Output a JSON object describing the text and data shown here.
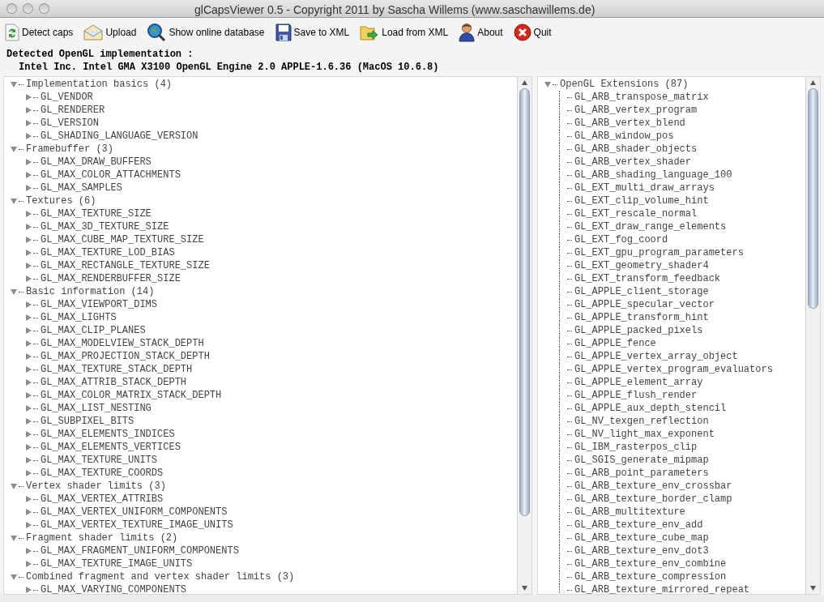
{
  "window": {
    "title": "glCapsViewer 0.5 - Copyright 2011 by Sascha Willems (www.saschawillems.de)"
  },
  "toolbar": [
    {
      "kind": "detect",
      "label": "Detect caps"
    },
    {
      "kind": "upload",
      "label": "Upload"
    },
    {
      "kind": "database",
      "label": "Show online database"
    },
    {
      "kind": "save",
      "label": "Save to XML"
    },
    {
      "kind": "load",
      "label": "Load from XML"
    },
    {
      "kind": "about",
      "label": "About"
    },
    {
      "kind": "quit",
      "label": "Quit"
    }
  ],
  "implementation": {
    "heading": "Detected OpenGL implementation :",
    "renderer": "Intel Inc. Intel GMA X3100 OpenGL Engine 2.0 APPLE-1.6.36 (MacOS 10.6.8)"
  },
  "caps_tree": [
    {
      "label": "Implementation basics (4)",
      "expanded": true,
      "children": [
        {
          "label": "GL_VENDOR",
          "expanded": false
        },
        {
          "label": "GL_RENDERER",
          "expanded": false
        },
        {
          "label": "GL_VERSION",
          "expanded": false
        },
        {
          "label": "GL_SHADING_LANGUAGE_VERSION",
          "expanded": false
        }
      ]
    },
    {
      "label": "Framebuffer (3)",
      "expanded": true,
      "children": [
        {
          "label": "GL_MAX_DRAW_BUFFERS",
          "expanded": false
        },
        {
          "label": "GL_MAX_COLOR_ATTACHMENTS",
          "expanded": false
        },
        {
          "label": "GL_MAX_SAMPLES",
          "expanded": false
        }
      ]
    },
    {
      "label": "Textures (6)",
      "expanded": true,
      "children": [
        {
          "label": "GL_MAX_TEXTURE_SIZE",
          "expanded": false
        },
        {
          "label": "GL_MAX_3D_TEXTURE_SIZE",
          "expanded": false
        },
        {
          "label": "GL_MAX_CUBE_MAP_TEXTURE_SIZE",
          "expanded": false
        },
        {
          "label": "GL_MAX_TEXTURE_LOD_BIAS",
          "expanded": false
        },
        {
          "label": "GL_MAX_RECTANGLE_TEXTURE_SIZE",
          "expanded": false
        },
        {
          "label": "GL_MAX_RENDERBUFFER_SIZE",
          "expanded": false
        }
      ]
    },
    {
      "label": "Basic information (14)",
      "expanded": true,
      "children": [
        {
          "label": "GL_MAX_VIEWPORT_DIMS",
          "expanded": false
        },
        {
          "label": "GL_MAX_LIGHTS",
          "expanded": false
        },
        {
          "label": "GL_MAX_CLIP_PLANES",
          "expanded": false
        },
        {
          "label": "GL_MAX_MODELVIEW_STACK_DEPTH",
          "expanded": false
        },
        {
          "label": "GL_MAX_PROJECTION_STACK_DEPTH",
          "expanded": false
        },
        {
          "label": "GL_MAX_TEXTURE_STACK_DEPTH",
          "expanded": false
        },
        {
          "label": "GL_MAX_ATTRIB_STACK_DEPTH",
          "expanded": false
        },
        {
          "label": "GL_MAX_COLOR_MATRIX_STACK_DEPTH",
          "expanded": false
        },
        {
          "label": "GL_MAX_LIST_NESTING",
          "expanded": false
        },
        {
          "label": "GL_SUBPIXEL_BITS",
          "expanded": false
        },
        {
          "label": "GL_MAX_ELEMENTS_INDICES",
          "expanded": false
        },
        {
          "label": "GL_MAX_ELEMENTS_VERTICES",
          "expanded": false
        },
        {
          "label": "GL_MAX_TEXTURE_UNITS",
          "expanded": false
        },
        {
          "label": "GL_MAX_TEXTURE_COORDS",
          "expanded": false
        }
      ]
    },
    {
      "label": "Vertex shader limits (3)",
      "expanded": true,
      "children": [
        {
          "label": "GL_MAX_VERTEX_ATTRIBS",
          "expanded": false
        },
        {
          "label": "GL_MAX_VERTEX_UNIFORM_COMPONENTS",
          "expanded": false
        },
        {
          "label": "GL_MAX_VERTEX_TEXTURE_IMAGE_UNITS",
          "expanded": false
        }
      ]
    },
    {
      "label": "Fragment shader limits (2)",
      "expanded": true,
      "children": [
        {
          "label": "GL_MAX_FRAGMENT_UNIFORM_COMPONENTS",
          "expanded": false
        },
        {
          "label": "GL_MAX_TEXTURE_IMAGE_UNITS",
          "expanded": false
        }
      ]
    },
    {
      "label": "Combined fragment and vertex shader limits (3)",
      "expanded": true,
      "children": [
        {
          "label": "GL_MAX_VARYING_COMPONENTS",
          "expanded": false
        }
      ]
    }
  ],
  "extensions_tree": [
    {
      "label": "OpenGL Extensions (87)",
      "expanded": true,
      "children": [
        {
          "label": "GL_ARB_transpose_matrix"
        },
        {
          "label": "GL_ARB_vertex_program"
        },
        {
          "label": "GL_ARB_vertex_blend"
        },
        {
          "label": "GL_ARB_window_pos"
        },
        {
          "label": "GL_ARB_shader_objects"
        },
        {
          "label": "GL_ARB_vertex_shader"
        },
        {
          "label": "GL_ARB_shading_language_100"
        },
        {
          "label": "GL_EXT_multi_draw_arrays"
        },
        {
          "label": "GL_EXT_clip_volume_hint"
        },
        {
          "label": "GL_EXT_rescale_normal"
        },
        {
          "label": "GL_EXT_draw_range_elements"
        },
        {
          "label": "GL_EXT_fog_coord"
        },
        {
          "label": "GL_EXT_gpu_program_parameters"
        },
        {
          "label": "GL_EXT_geometry_shader4"
        },
        {
          "label": "GL_EXT_transform_feedback"
        },
        {
          "label": "GL_APPLE_client_storage"
        },
        {
          "label": "GL_APPLE_specular_vector"
        },
        {
          "label": "GL_APPLE_transform_hint"
        },
        {
          "label": "GL_APPLE_packed_pixels"
        },
        {
          "label": "GL_APPLE_fence"
        },
        {
          "label": "GL_APPLE_vertex_array_object"
        },
        {
          "label": "GL_APPLE_vertex_program_evaluators"
        },
        {
          "label": "GL_APPLE_element_array"
        },
        {
          "label": "GL_APPLE_flush_render"
        },
        {
          "label": "GL_APPLE_aux_depth_stencil"
        },
        {
          "label": "GL_NV_texgen_reflection"
        },
        {
          "label": "GL_NV_light_max_exponent"
        },
        {
          "label": "GL_IBM_rasterpos_clip"
        },
        {
          "label": "GL_SGIS_generate_mipmap"
        },
        {
          "label": "GL_ARB_point_parameters"
        },
        {
          "label": "GL_ARB_texture_env_crossbar"
        },
        {
          "label": "GL_ARB_texture_border_clamp"
        },
        {
          "label": "GL_ARB_multitexture"
        },
        {
          "label": "GL_ARB_texture_env_add"
        },
        {
          "label": "GL_ARB_texture_cube_map"
        },
        {
          "label": "GL_ARB_texture_env_dot3"
        },
        {
          "label": "GL_ARB_texture_env_combine"
        },
        {
          "label": "GL_ARB_texture_compression"
        },
        {
          "label": "GL_ARB_texture_mirrored_repeat"
        }
      ]
    }
  ]
}
